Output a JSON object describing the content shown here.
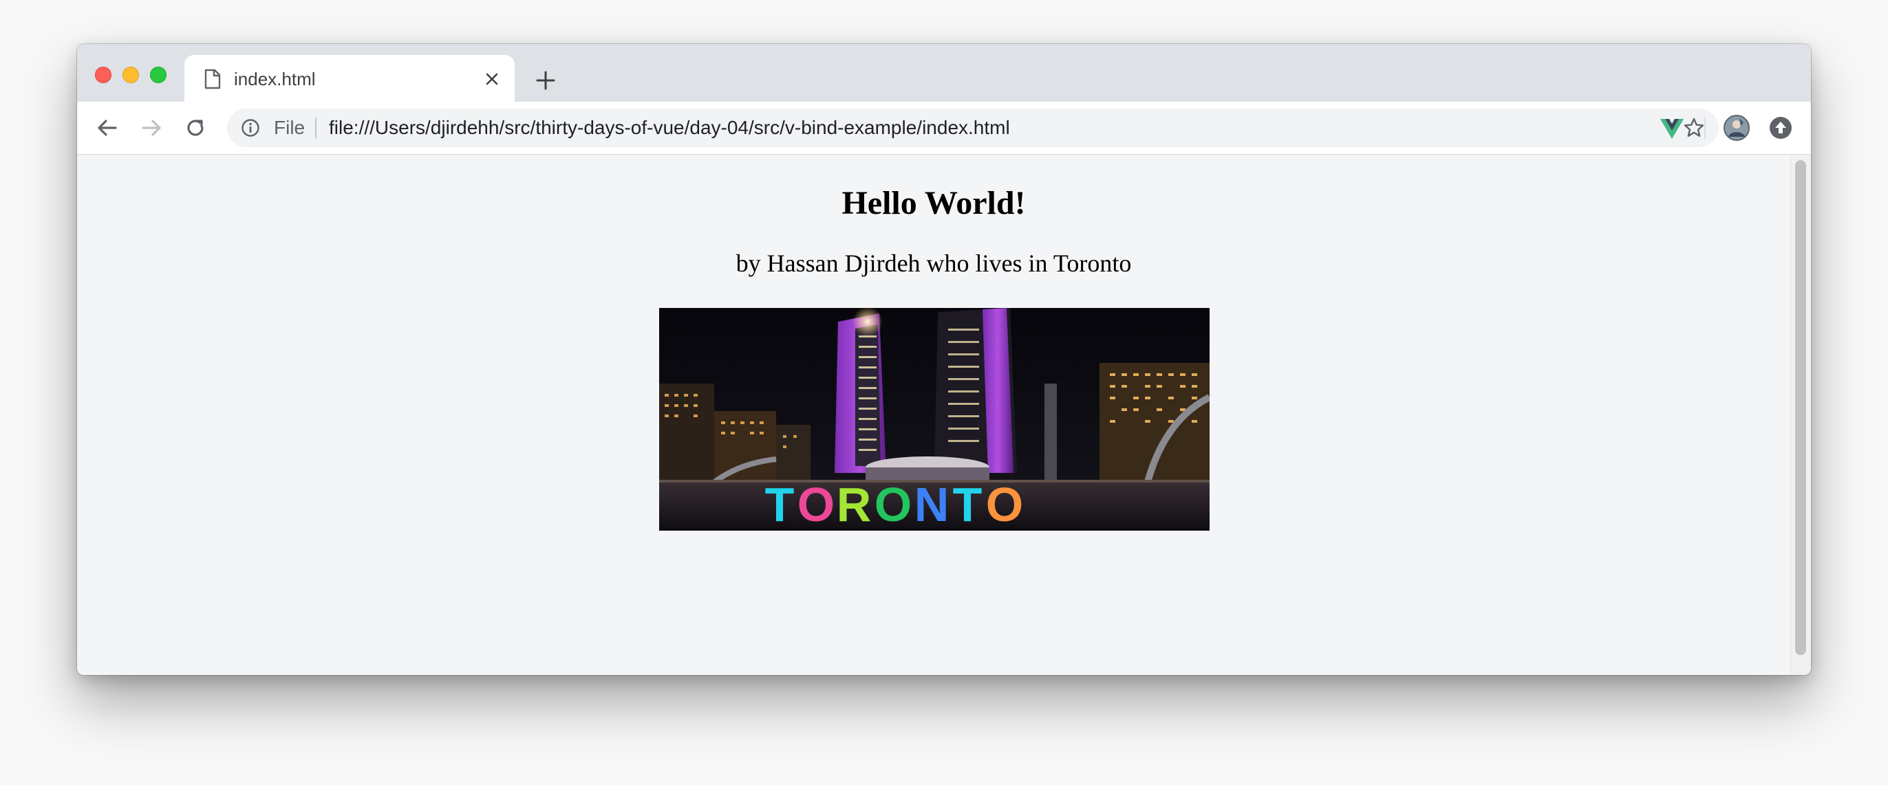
{
  "browser": {
    "tab": {
      "title": "index.html"
    },
    "address": {
      "scheme_label": "File",
      "url": "file:///Users/djirdehh/src/thirty-days-of-vue/day-04/src/v-bind-example/index.html"
    },
    "icons": {
      "back": "arrow-left-icon",
      "forward": "arrow-right-icon",
      "reload": "reload-icon",
      "info": "info-icon",
      "star": "star-icon",
      "vue_devtools": "vue-logo-icon",
      "profile": "avatar-icon",
      "update": "update-arrow-icon"
    },
    "colors": {
      "vue_green": "#42b883",
      "vue_dark": "#35495e",
      "traffic_red": "#fe5f57",
      "traffic_yellow": "#febc2e",
      "traffic_green": "#28c840"
    }
  },
  "page": {
    "heading": "Hello World!",
    "byline": "by Hassan Djirdeh who lives in Toronto",
    "image": {
      "sign_text": "TORONTO",
      "sign_colors": [
        "#22d3ee",
        "#ec4899",
        "#a3e635",
        "#22c55e",
        "#3b82f6",
        "#22d3ee",
        "#fb923c"
      ]
    }
  }
}
